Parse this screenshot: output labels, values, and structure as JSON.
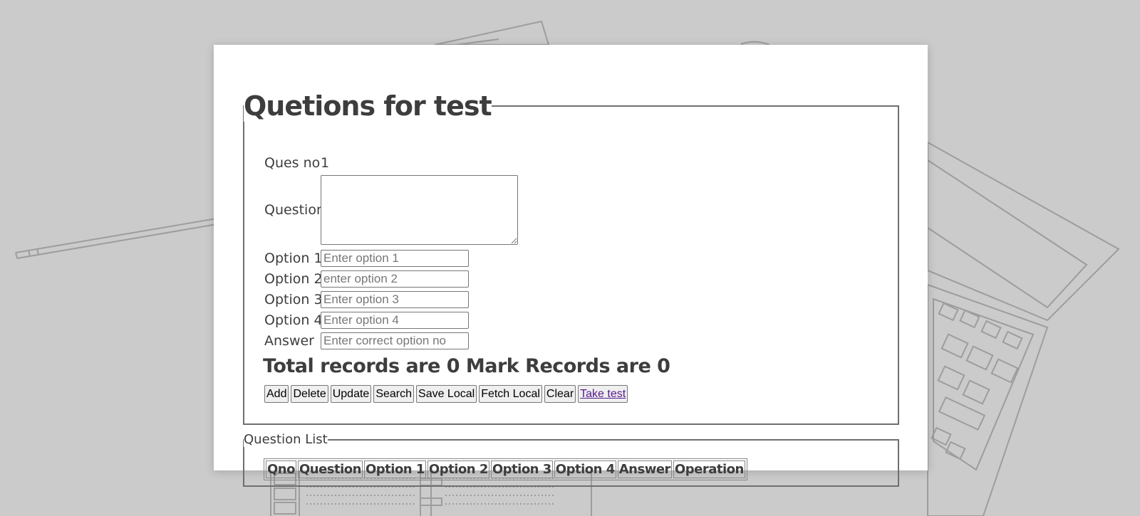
{
  "form": {
    "title": "Quetions for test",
    "ques_no_label": "Ques no",
    "ques_no_value": "1",
    "question_label": "Question",
    "option1_label": "Option 1",
    "option1_placeholder": "Enter option 1",
    "option2_label": "Option 2",
    "option2_placeholder": "enter option 2",
    "option3_label": "Option 3",
    "option3_placeholder": "Enter option 3",
    "option4_label": "Option 4",
    "option4_placeholder": "Enter option 4",
    "answer_label": "Answer",
    "answer_placeholder": "Enter correct option no",
    "records_text": "Total records are 0 Mark Records are 0"
  },
  "buttons": {
    "add": "Add",
    "delete": "Delete",
    "update": "Update",
    "search": "Search",
    "save_local": "Save Local",
    "fetch_local": "Fetch Local",
    "clear": "Clear",
    "take_test": "Take test"
  },
  "list": {
    "title": "Question List",
    "columns": [
      "Qno",
      "Question",
      "Option 1",
      "Option 2",
      "Option 3",
      "Option 4",
      "Answer",
      "Operation"
    ]
  },
  "colors": {
    "page_background": "#cbcbcb",
    "card_background": "#ffffff",
    "link": "#551a8b"
  }
}
